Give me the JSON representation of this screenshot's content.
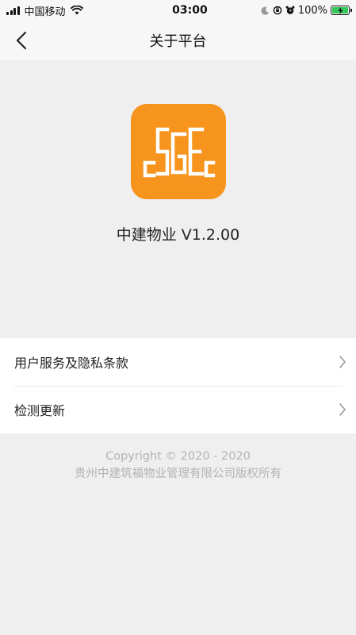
{
  "status_bar": {
    "carrier": "中国移动",
    "time": "03:00",
    "battery": "100%"
  },
  "nav": {
    "title": "关于平台"
  },
  "app": {
    "version_label": "中建物业 V1.2.00",
    "logo_color": "#f7941d"
  },
  "list": {
    "items": [
      {
        "label": "用户服务及隐私条款",
        "icon": "chevron-right-icon"
      },
      {
        "label": "检测更新",
        "icon": "chevron-right-icon"
      }
    ]
  },
  "footer": {
    "copyright": "Copyright © 2020 - 2020",
    "company": "贵州中建筑福物业管理有限公司版权所有"
  }
}
